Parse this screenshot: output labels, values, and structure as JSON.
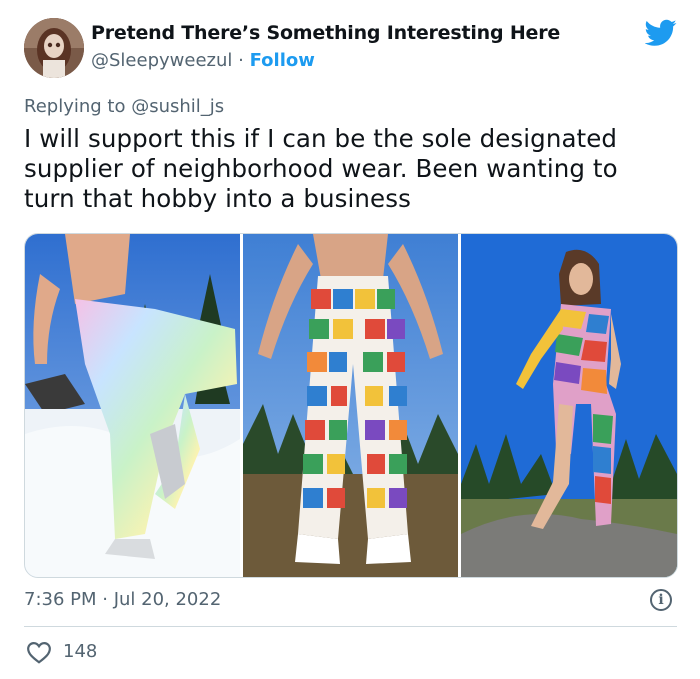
{
  "tweet": {
    "author_name": "Pretend There’s Something Interesting Here",
    "author_handle": "@Sleepyweezul",
    "separator": "·",
    "follow_label": "Follow",
    "reply_prefix": "Replying to ",
    "reply_handle": "@sushil_js",
    "text": "I will support this if I can be the sole designated supplier of neighborhood wear. Been wanting to turn that hobby into a business",
    "timestamp": "7:36 PM · Jul 20, 2022",
    "like_count": "148"
  },
  "icons": {
    "brand": "twitter-bird-icon",
    "info": "info-icon",
    "info_glyph": "i",
    "like": "heart-icon"
  },
  "colors": {
    "accent": "#1d9bf0",
    "text": "#0f1419",
    "secondary": "#536471",
    "border": "#cfd9de"
  },
  "media": {
    "photos": [
      {
        "subject": "pastel-rainbow-crochet-pants-in-snow"
      },
      {
        "subject": "granny-square-crochet-pants-with-fringe"
      },
      {
        "subject": "patchwork-crochet-one-leg-bodysuit"
      }
    ]
  }
}
